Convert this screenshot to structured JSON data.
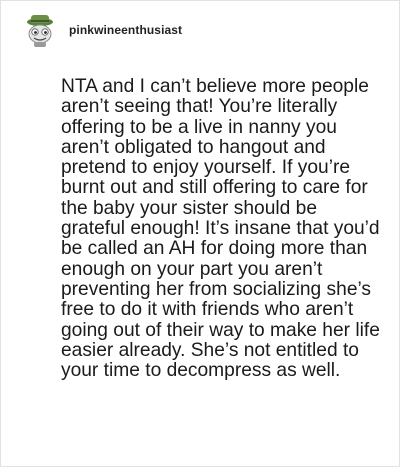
{
  "post": {
    "username": "pinkwineenthusiast",
    "avatar_icon": "frog-with-hat-avatar",
    "body": "NTA and I can’t believe more people aren’t seeing that! You’re literally offering to be a live in nanny you aren’t obligated to hangout and pretend to enjoy yourself. If you’re burnt out and still offering to care for the baby your sister should be grateful enough! It’s insane that you’d be called an AH for doing more than enough on your part you aren’t preventing her from socializing she’s free to do it with friends who aren’t going out of their way to make her life easier already. She’s not entitled to your time to decompress as well."
  },
  "colors": {
    "text": "#1b1b1b",
    "avatar_hat": "#4f7a3a",
    "avatar_face": "#e8e8e8"
  }
}
